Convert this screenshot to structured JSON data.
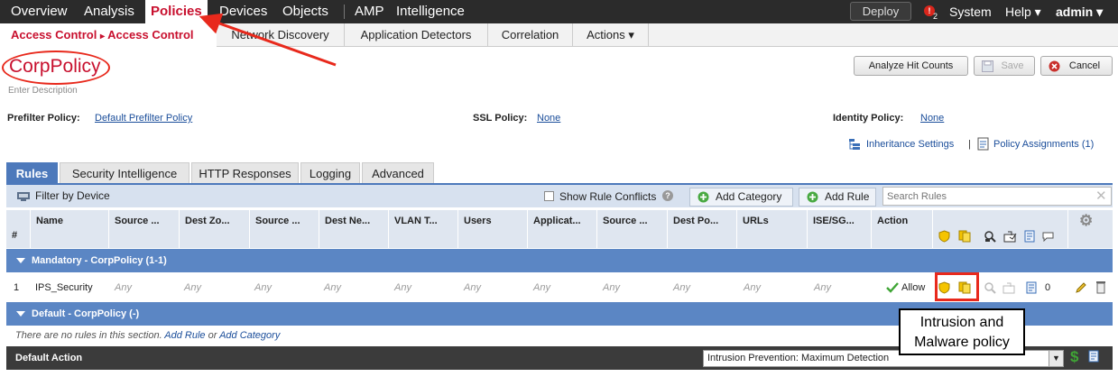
{
  "topnav": {
    "items": [
      "Overview",
      "Analysis",
      "Policies",
      "Devices",
      "Objects",
      "AMP",
      "Intelligence"
    ],
    "deploy": "Deploy",
    "alert_count": "2",
    "system": "System",
    "help": "Help ▾",
    "user": "admin ▾"
  },
  "subnav": {
    "crumb1": "Access Control",
    "crumb_sep": "▸",
    "crumb2": "Access Control",
    "tabs": [
      "Network Discovery",
      "Application Detectors",
      "Correlation",
      "Actions ▾"
    ]
  },
  "policy": {
    "name": "CorpPolicy",
    "description_placeholder": "Enter Description"
  },
  "buttons": {
    "analyze": "Analyze Hit Counts",
    "save": "Save",
    "cancel": "Cancel"
  },
  "settings": {
    "prefilter_label": "Prefilter Policy:",
    "prefilter_value": "Default Prefilter Policy",
    "ssl_label": "SSL Policy:",
    "ssl_value": "None",
    "identity_label": "Identity Policy:",
    "identity_value": "None",
    "inheritance": "Inheritance Settings",
    "sep": "|",
    "assignments": "Policy Assignments (1)"
  },
  "policy_tabs": [
    "Rules",
    "Security Intelligence",
    "HTTP Responses",
    "Logging",
    "Advanced"
  ],
  "toolbar": {
    "filter": "Filter by Device",
    "show_conflicts": "Show Rule Conflicts",
    "add_category": "Add Category",
    "add_rule": "Add Rule",
    "search_placeholder": "Search Rules"
  },
  "table": {
    "columns": [
      "#",
      "Name",
      "Source ...",
      "Dest Zo...",
      "Source ...",
      "Dest Ne...",
      "VLAN T...",
      "Users",
      "Applicat...",
      "Source ...",
      "Dest Po...",
      "URLs",
      "ISE/SG...",
      "Action"
    ]
  },
  "sections": {
    "mandatory": "Mandatory - CorpPolicy (1-1)",
    "default": "Default - CorpPolicy (-)"
  },
  "rule": {
    "num": "1",
    "name": "IPS_Security",
    "any": "Any",
    "action": "Allow",
    "hits": "0"
  },
  "norules": {
    "text1": "There are no rules in this section.",
    "add_rule": "Add Rule",
    "or": "or",
    "add_category": "Add Category"
  },
  "default_action": {
    "label": "Default Action",
    "value": "Intrusion Prevention: Maximum Detection"
  },
  "callout": {
    "line1": "Intrusion and",
    "line2": "Malware policy"
  },
  "colors": {
    "accent_red": "#c8102e",
    "section_blue": "#5b86c4",
    "annotation_red": "#e8291c"
  }
}
